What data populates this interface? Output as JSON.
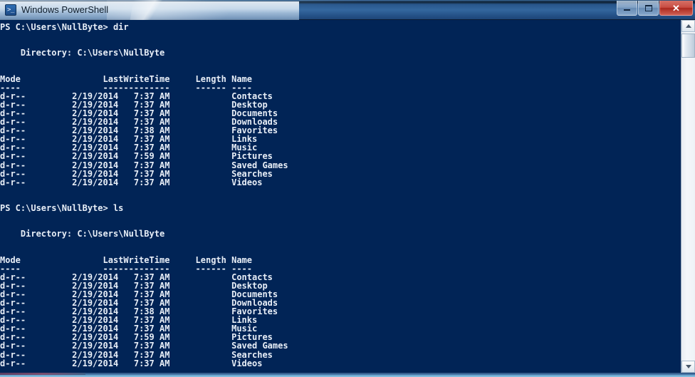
{
  "window": {
    "title": "Windows PowerShell",
    "icon": "powershell-prompt-icon",
    "colors": {
      "console_background": "#012456",
      "console_text": "#e8eef7",
      "titlebar_accent": "#2f5d90",
      "close_button": "#b0261a"
    },
    "controls": {
      "minimize_label": "Minimize",
      "maximize_label": "Maximize",
      "close_label": "Close",
      "close_glyph": "✕"
    }
  },
  "scrollbar": {
    "up_label": "Scroll up",
    "down_label": "Scroll down",
    "thumb_label": "Scroll thumb"
  },
  "console": {
    "prompt": "PS C:\\Users\\NullByte>",
    "blocks": [
      {
        "command": "dir",
        "prompt_line": "PS C:\\Users\\NullByte> dir",
        "directory_line": "    Directory: C:\\Users\\NullByte",
        "header_line": "Mode                LastWriteTime     Length Name",
        "separator_line": "----                -------------     ------ ----",
        "headers": [
          "Mode",
          "LastWriteTime",
          "Length",
          "Name"
        ],
        "rows": [
          {
            "mode": "d-r--",
            "date": "2/19/2014",
            "time": "7:37 AM",
            "length": "",
            "name": "Contacts",
            "line": "d-r--         2/19/2014   7:37 AM            Contacts"
          },
          {
            "mode": "d-r--",
            "date": "2/19/2014",
            "time": "7:37 AM",
            "length": "",
            "name": "Desktop",
            "line": "d-r--         2/19/2014   7:37 AM            Desktop"
          },
          {
            "mode": "d-r--",
            "date": "2/19/2014",
            "time": "7:37 AM",
            "length": "",
            "name": "Documents",
            "line": "d-r--         2/19/2014   7:37 AM            Documents"
          },
          {
            "mode": "d-r--",
            "date": "2/19/2014",
            "time": "7:37 AM",
            "length": "",
            "name": "Downloads",
            "line": "d-r--         2/19/2014   7:37 AM            Downloads"
          },
          {
            "mode": "d-r--",
            "date": "2/19/2014",
            "time": "7:38 AM",
            "length": "",
            "name": "Favorites",
            "line": "d-r--         2/19/2014   7:38 AM            Favorites"
          },
          {
            "mode": "d-r--",
            "date": "2/19/2014",
            "time": "7:37 AM",
            "length": "",
            "name": "Links",
            "line": "d-r--         2/19/2014   7:37 AM            Links"
          },
          {
            "mode": "d-r--",
            "date": "2/19/2014",
            "time": "7:37 AM",
            "length": "",
            "name": "Music",
            "line": "d-r--         2/19/2014   7:37 AM            Music"
          },
          {
            "mode": "d-r--",
            "date": "2/19/2014",
            "time": "7:59 AM",
            "length": "",
            "name": "Pictures",
            "line": "d-r--         2/19/2014   7:59 AM            Pictures"
          },
          {
            "mode": "d-r--",
            "date": "2/19/2014",
            "time": "7:37 AM",
            "length": "",
            "name": "Saved Games",
            "line": "d-r--         2/19/2014   7:37 AM            Saved Games"
          },
          {
            "mode": "d-r--",
            "date": "2/19/2014",
            "time": "7:37 AM",
            "length": "",
            "name": "Searches",
            "line": "d-r--         2/19/2014   7:37 AM            Searches"
          },
          {
            "mode": "d-r--",
            "date": "2/19/2014",
            "time": "7:37 AM",
            "length": "",
            "name": "Videos",
            "line": "d-r--         2/19/2014   7:37 AM            Videos"
          }
        ]
      },
      {
        "command": "ls",
        "prompt_line": "PS C:\\Users\\NullByte> ls",
        "directory_line": "    Directory: C:\\Users\\NullByte",
        "header_line": "Mode                LastWriteTime     Length Name",
        "separator_line": "----                -------------     ------ ----",
        "headers": [
          "Mode",
          "LastWriteTime",
          "Length",
          "Name"
        ],
        "rows": [
          {
            "mode": "d-r--",
            "date": "2/19/2014",
            "time": "7:37 AM",
            "length": "",
            "name": "Contacts",
            "line": "d-r--         2/19/2014   7:37 AM            Contacts"
          },
          {
            "mode": "d-r--",
            "date": "2/19/2014",
            "time": "7:37 AM",
            "length": "",
            "name": "Desktop",
            "line": "d-r--         2/19/2014   7:37 AM            Desktop"
          },
          {
            "mode": "d-r--",
            "date": "2/19/2014",
            "time": "7:37 AM",
            "length": "",
            "name": "Documents",
            "line": "d-r--         2/19/2014   7:37 AM            Documents"
          },
          {
            "mode": "d-r--",
            "date": "2/19/2014",
            "time": "7:37 AM",
            "length": "",
            "name": "Downloads",
            "line": "d-r--         2/19/2014   7:37 AM            Downloads"
          },
          {
            "mode": "d-r--",
            "date": "2/19/2014",
            "time": "7:38 AM",
            "length": "",
            "name": "Favorites",
            "line": "d-r--         2/19/2014   7:38 AM            Favorites"
          },
          {
            "mode": "d-r--",
            "date": "2/19/2014",
            "time": "7:37 AM",
            "length": "",
            "name": "Links",
            "line": "d-r--         2/19/2014   7:37 AM            Links"
          },
          {
            "mode": "d-r--",
            "date": "2/19/2014",
            "time": "7:37 AM",
            "length": "",
            "name": "Music",
            "line": "d-r--         2/19/2014   7:37 AM            Music"
          },
          {
            "mode": "d-r--",
            "date": "2/19/2014",
            "time": "7:59 AM",
            "length": "",
            "name": "Pictures",
            "line": "d-r--         2/19/2014   7:59 AM            Pictures"
          },
          {
            "mode": "d-r--",
            "date": "2/19/2014",
            "time": "7:37 AM",
            "length": "",
            "name": "Saved Games",
            "line": "d-r--         2/19/2014   7:37 AM            Saved Games"
          },
          {
            "mode": "d-r--",
            "date": "2/19/2014",
            "time": "7:37 AM",
            "length": "",
            "name": "Searches",
            "line": "d-r--         2/19/2014   7:37 AM            Searches"
          },
          {
            "mode": "d-r--",
            "date": "2/19/2014",
            "time": "7:37 AM",
            "length": "",
            "name": "Videos",
            "line": "d-r--         2/19/2014   7:37 AM            Videos"
          }
        ]
      }
    ]
  }
}
